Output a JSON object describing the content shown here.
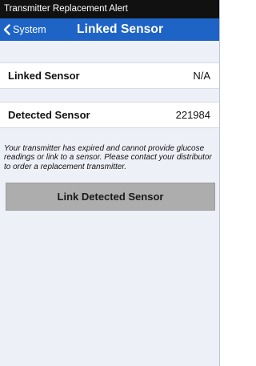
{
  "alert": {
    "title": "Transmitter Replacement Alert"
  },
  "nav": {
    "back_label": "System",
    "title": "Linked Sensor"
  },
  "rows": [
    {
      "label": "Linked Sensor",
      "value": "N/A"
    },
    {
      "label": "Detected Sensor",
      "value": "221984"
    }
  ],
  "note": "Your transmitter has expired and cannot provide glucose readings or link to a sensor. Please contact your distributor to order a replacement transmitter.",
  "button": {
    "label": "Link Detected Sensor"
  },
  "colors": {
    "nav_background": "#1e64c6",
    "alert_background": "#111111",
    "page_background": "#eef0f8",
    "button_background": "#adadad"
  },
  "icons": {
    "back": "chevron-left-icon"
  }
}
